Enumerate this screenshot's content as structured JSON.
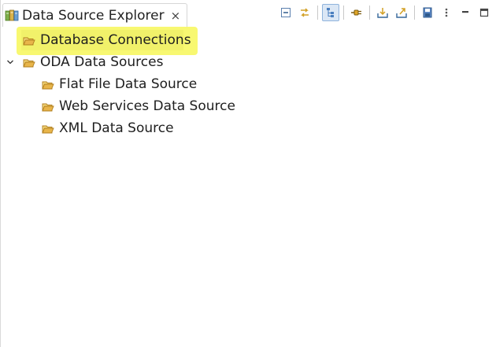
{
  "view": {
    "tab_title": "Data Source Explorer",
    "tab_close_symbol": "×",
    "tab_icon": "data-source-explorer-icon"
  },
  "toolbar": {
    "buttons": [
      {
        "name": "collapse-all-icon"
      },
      {
        "name": "link-with-editor-icon"
      },
      {
        "name": "tree-layout-icon",
        "active": true
      },
      {
        "name": "connect-icon"
      },
      {
        "name": "import-icon"
      },
      {
        "name": "export-icon"
      },
      {
        "name": "save-icon"
      },
      {
        "name": "view-menu-icon"
      },
      {
        "name": "minimize-icon"
      },
      {
        "name": "maximize-icon"
      }
    ]
  },
  "tree": {
    "items": [
      {
        "label": "Database Connections",
        "level": 0,
        "expandable": false,
        "selected": true,
        "highlighted": true
      },
      {
        "label": "ODA Data Sources",
        "level": 0,
        "expandable": true,
        "expanded": true
      },
      {
        "label": "Flat File Data Source",
        "level": 1,
        "expandable": false
      },
      {
        "label": "Web Services Data Source",
        "level": 1,
        "expandable": false
      },
      {
        "label": "XML Data Source",
        "level": 1,
        "expandable": false
      }
    ]
  },
  "colors": {
    "highlight": "#f5f542",
    "folder": "#e8b54a",
    "folder_outline": "#b07d1c",
    "active_button": "#dbe7f5"
  }
}
